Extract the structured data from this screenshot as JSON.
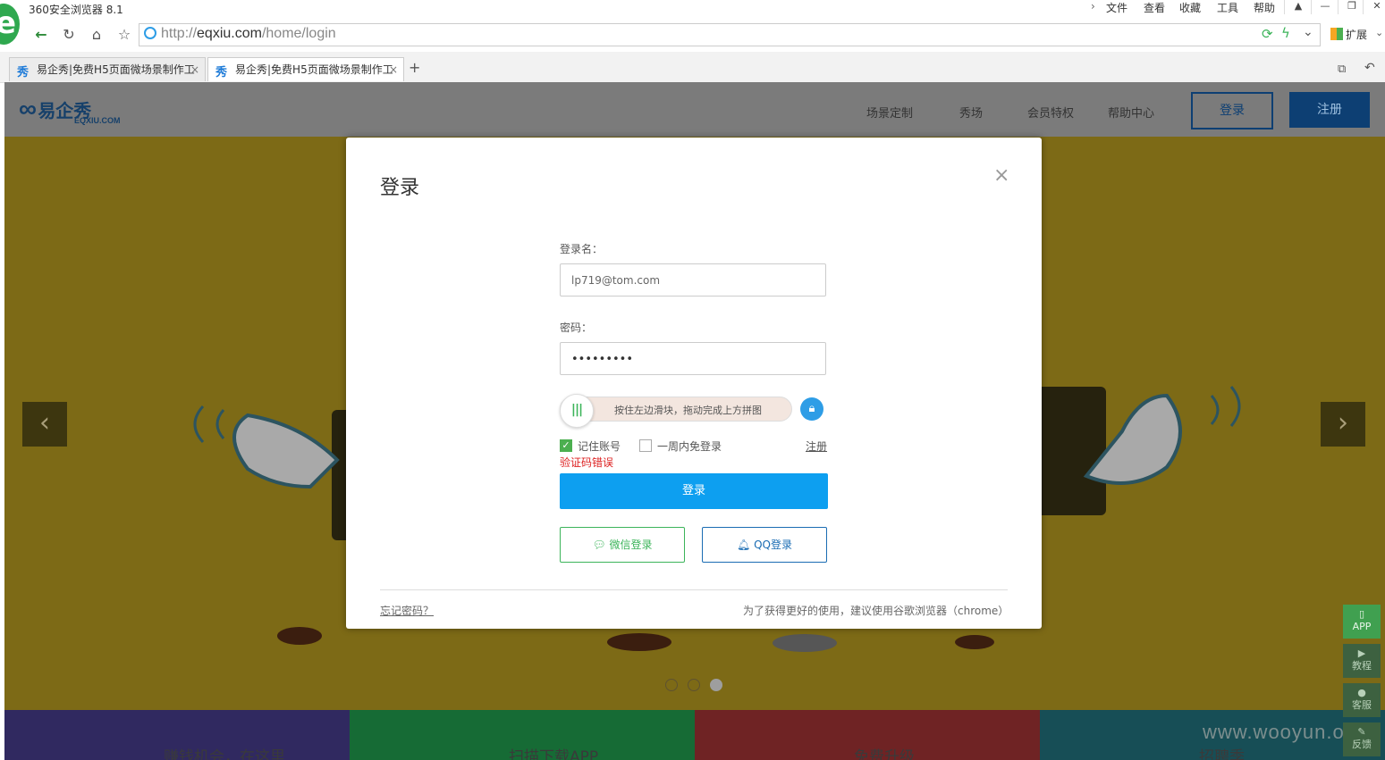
{
  "browser": {
    "title": "360安全浏览器 8.1",
    "logo_glyph": "e",
    "menu": [
      "文件",
      "查看",
      "收藏",
      "工具",
      "帮助"
    ],
    "url_prefix": "http://",
    "url_domain": "eqxiu.com",
    "url_path": "/home/login",
    "extensions_label": "扩展",
    "tabs": [
      {
        "icon": "秀",
        "label": "易企秀|免费H5页面微场景制作工"
      },
      {
        "icon": "秀",
        "label": "易企秀|免费H5页面微场景制作工"
      }
    ],
    "new_tab": "+"
  },
  "site": {
    "logo_text": "易企秀",
    "logo_sub": "EQXIU.COM",
    "nav": [
      "场景定制",
      "秀场",
      "会员特权",
      "帮助中心"
    ],
    "login_label": "登录",
    "register_label": "注册",
    "bottom_strips": [
      "赚钱机会，在这里",
      "扫描下载APP",
      "免费升级",
      "招聘季"
    ],
    "side_buttons": [
      "APP",
      "教程",
      "客服",
      "反馈"
    ],
    "watermark": "www.wooyun.org",
    "colors": {
      "primary": "#0d9ff0",
      "banner": "#f5d02d",
      "dark_nav": "#0d3f73"
    }
  },
  "modal": {
    "title": "登录",
    "close": "×",
    "username_label": "登录名：",
    "username_value": "lp719@tom.com",
    "password_label": "密码：",
    "password_value": "•••••••••",
    "slider_hint": "按住左边滑块，拖动完成上方拼图",
    "remember_label": "记住账号",
    "remember_checked": true,
    "week_label": "一周内免登录",
    "week_checked": false,
    "register_link": "注册",
    "error": "验证码错误",
    "submit_label": "登录",
    "wechat_label": "微信登录",
    "qq_label": "QQ登录",
    "forgot_label": "忘记密码？",
    "tip": "为了获得更好的使用，建议使用谷歌浏览器（chrome）"
  }
}
